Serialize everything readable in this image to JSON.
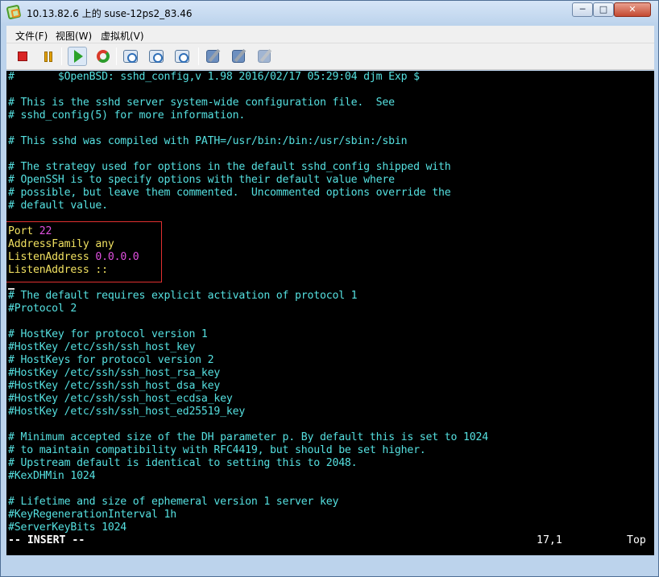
{
  "window": {
    "title": "10.13.82.6 上的 suse-12ps2_83.46",
    "buttons": {
      "minimize": "─",
      "maximize": "□",
      "close": "✕"
    }
  },
  "menu": {
    "items": [
      "文件(F)",
      "视图(W)",
      "虚拟机(V)"
    ]
  },
  "toolbar": {
    "icons": [
      "stop-icon",
      "pause-icon",
      "play-icon",
      "reset-icon",
      "snapshot-take-icon",
      "snapshot-revert-icon",
      "snapshot-manager-icon",
      "console-icon",
      "edit-settings-icon",
      "tools-icon"
    ]
  },
  "terminal": {
    "lines": [
      {
        "text": "#       $OpenBSD: sshd_config,v 1.98 2016/02/17 05:29:04 djm Exp $",
        "kind": "comment"
      },
      {
        "text": "",
        "kind": "empty"
      },
      {
        "text": "# This is the sshd server system-wide configuration file.  See",
        "kind": "comment"
      },
      {
        "text": "# sshd_config(5) for more information.",
        "kind": "comment"
      },
      {
        "text": "",
        "kind": "empty"
      },
      {
        "text": "# This sshd was compiled with PATH=/usr/bin:/bin:/usr/sbin:/sbin",
        "kind": "comment"
      },
      {
        "text": "",
        "kind": "empty"
      },
      {
        "text": "# The strategy used for options in the default sshd_config shipped with",
        "kind": "comment"
      },
      {
        "text": "# OpenSSH is to specify options with their default value where",
        "kind": "comment"
      },
      {
        "text": "# possible, but leave them commented.  Uncommented options override the",
        "kind": "comment"
      },
      {
        "text": "# default value.",
        "kind": "comment"
      },
      {
        "text": "",
        "kind": "empty"
      },
      {
        "key": "Port",
        "value": "22",
        "value_kind": "number",
        "kind": "directive"
      },
      {
        "key": "AddressFamily",
        "value": "any",
        "value_kind": "word",
        "kind": "directive"
      },
      {
        "key": "ListenAddress",
        "value": "0.0.0.0",
        "value_kind": "number",
        "kind": "directive"
      },
      {
        "key": "ListenAddress",
        "value": "::",
        "value_kind": "word",
        "kind": "directive"
      },
      {
        "text": "",
        "kind": "empty"
      },
      {
        "text": "# The default requires explicit activation of protocol 1",
        "kind": "comment"
      },
      {
        "text": "#Protocol 2",
        "kind": "comment"
      },
      {
        "text": "",
        "kind": "empty"
      },
      {
        "text": "# HostKey for protocol version 1",
        "kind": "comment"
      },
      {
        "text": "#HostKey /etc/ssh/ssh_host_key",
        "kind": "comment"
      },
      {
        "text": "# HostKeys for protocol version 2",
        "kind": "comment"
      },
      {
        "text": "#HostKey /etc/ssh/ssh_host_rsa_key",
        "kind": "comment"
      },
      {
        "text": "#HostKey /etc/ssh/ssh_host_dsa_key",
        "kind": "comment"
      },
      {
        "text": "#HostKey /etc/ssh/ssh_host_ecdsa_key",
        "kind": "comment"
      },
      {
        "text": "#HostKey /etc/ssh/ssh_host_ed25519_key",
        "kind": "comment"
      },
      {
        "text": "",
        "kind": "empty"
      },
      {
        "text": "# Minimum accepted size of the DH parameter p. By default this is set to 1024",
        "kind": "comment"
      },
      {
        "text": "# to maintain compatibility with RFC4419, but should be set higher.",
        "kind": "comment"
      },
      {
        "text": "# Upstream default is identical to setting this to 2048.",
        "kind": "comment"
      },
      {
        "text": "#KexDHMin 1024",
        "kind": "comment"
      },
      {
        "text": "",
        "kind": "empty"
      },
      {
        "text": "# Lifetime and size of ephemeral version 1 server key",
        "kind": "comment"
      },
      {
        "text": "#KeyRegenerationInterval 1h",
        "kind": "comment"
      },
      {
        "text": "#ServerKeyBits 1024",
        "kind": "comment"
      }
    ],
    "status": {
      "mode": "-- INSERT --",
      "position": "17,1",
      "scroll": "Top"
    }
  },
  "colors": {
    "background": "#000000",
    "comment": "#55e0e0",
    "keyword": "#f0e060",
    "value": "#e050e0",
    "highlight": "#e23030"
  }
}
